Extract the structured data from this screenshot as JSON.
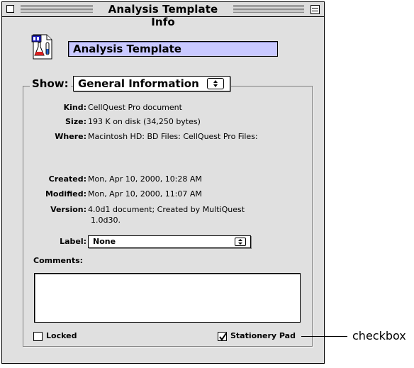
{
  "window": {
    "title": "Analysis Template Info",
    "file_name": "Analysis Template",
    "icon": "cellquest-document-flask-icon"
  },
  "show": {
    "label": "Show:",
    "selected": "General Information"
  },
  "info": {
    "kind": {
      "label": "Kind:",
      "value": "CellQuest Pro document"
    },
    "size": {
      "label": "Size:",
      "value": "193 K on disk (34,250 bytes)"
    },
    "where": {
      "label": "Where:",
      "value": "Macintosh HD: BD Files: CellQuest Pro Files:"
    },
    "created": {
      "label": "Created:",
      "value": "Mon, Apr 10, 2000, 10:28 AM"
    },
    "modified": {
      "label": "Modified:",
      "value": "Mon, Apr 10, 2000, 11:07 AM"
    },
    "version": {
      "label": "Version:",
      "value_line1": "4.0d1 document; Created by MultiQuest",
      "value_line2": "1.0d30."
    }
  },
  "label_popup": {
    "label": "Label:",
    "selected": "None"
  },
  "comments": {
    "label": "Comments:",
    "value": ""
  },
  "locked": {
    "label": "Locked",
    "checked": false
  },
  "stationery_pad": {
    "label": "Stationery Pad",
    "checked": true
  },
  "annotation": {
    "text": "checkbox"
  },
  "colors": {
    "window_bg": "#e0e0e0",
    "name_field_bg": "#c9c9ff"
  }
}
